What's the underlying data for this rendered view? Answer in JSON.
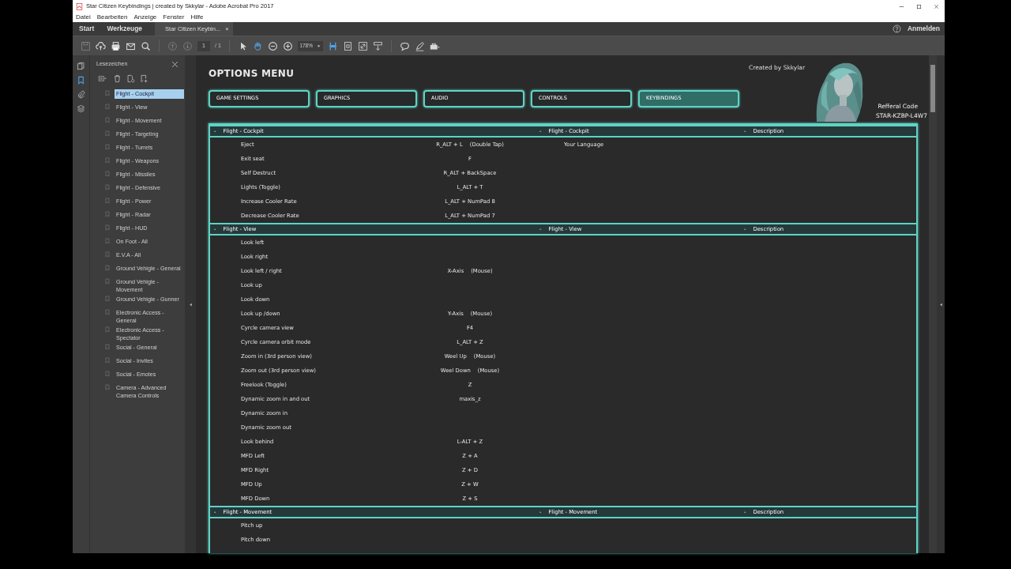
{
  "window": {
    "title": "Star Citizen Keybindings | created by Skkylar - Adobe Acrobat Pro 2017"
  },
  "menu": [
    "Datei",
    "Bearbeiten",
    "Anzeige",
    "Fenster",
    "Hilfe"
  ],
  "tabs": [
    {
      "label": "Start",
      "kind": "nav"
    },
    {
      "label": "Werkzeuge",
      "kind": "nav"
    },
    {
      "label": "Star Citizen Keybin...",
      "kind": "document",
      "close": "×"
    }
  ],
  "account": {
    "label": "Anmelden"
  },
  "toolbar": {
    "groups": [
      [
        {
          "kind": "save",
          "disabled": true,
          "active": false
        },
        {
          "kind": "upload",
          "disabled": false,
          "active": false
        },
        {
          "kind": "print",
          "disabled": false,
          "active": false
        },
        {
          "kind": "mail",
          "disabled": false,
          "active": false
        },
        {
          "kind": "search",
          "disabled": false,
          "active": false
        }
      ],
      [
        {
          "kind": "prev",
          "disabled": true,
          "active": false
        },
        {
          "kind": "next",
          "disabled": true,
          "active": false
        }
      ],
      [
        {
          "kind": "pointer",
          "disabled": false,
          "active": false
        },
        {
          "kind": "hand",
          "disabled": false,
          "active": true
        },
        {
          "kind": "zoomout",
          "disabled": false,
          "active": false
        },
        {
          "kind": "zoomin",
          "disabled": false,
          "active": false
        }
      ],
      [
        {
          "kind": "fitwidth",
          "disabled": false,
          "active": true
        },
        {
          "kind": "fitpage",
          "disabled": false,
          "active": false
        },
        {
          "kind": "fullscreen",
          "disabled": false,
          "active": false
        },
        {
          "kind": "scroll",
          "disabled": false,
          "active": false
        }
      ],
      [
        {
          "kind": "comment",
          "disabled": false,
          "active": false
        },
        {
          "kind": "pen",
          "disabled": false,
          "active": false
        },
        {
          "kind": "toolbox",
          "disabled": false,
          "active": false
        }
      ]
    ],
    "page": "1",
    "page_total": "/ 1",
    "zoom": "178%"
  },
  "side_icons": [
    {
      "kind": "pages",
      "selected": false
    },
    {
      "kind": "bookmarks",
      "selected": true
    },
    {
      "kind": "attachments",
      "selected": false
    },
    {
      "kind": "layers",
      "selected": false
    }
  ],
  "bookmarks": {
    "title": "Lesezeichen",
    "items": [
      {
        "label": "Flight - Cockpit",
        "selected": true
      },
      {
        "label": "Flight - View",
        "selected": false
      },
      {
        "label": "Flight - Movement",
        "selected": false
      },
      {
        "label": "Flight - Targeting",
        "selected": false
      },
      {
        "label": "Flight - Turrets",
        "selected": false
      },
      {
        "label": "Flight - Weapons",
        "selected": false
      },
      {
        "label": "Flight - Missiles",
        "selected": false
      },
      {
        "label": "Flight - Defensive",
        "selected": false
      },
      {
        "label": "Flight - Power",
        "selected": false
      },
      {
        "label": "Flight - Radar",
        "selected": false
      },
      {
        "label": "Flight - HUD",
        "selected": false
      },
      {
        "label": "On Foot - All",
        "selected": false
      },
      {
        "label": "E.V.A - All",
        "selected": false
      },
      {
        "label": "Ground Vehigle - General",
        "selected": false
      },
      {
        "label": "Ground Vehigle - Movement",
        "selected": false
      },
      {
        "label": "Ground Vehigle - Gunner",
        "selected": false
      },
      {
        "label": "Electronic Access - General",
        "selected": false
      },
      {
        "label": "Electronic Access - Spectator",
        "selected": false
      },
      {
        "label": "Social - General",
        "selected": false
      },
      {
        "label": "Social - Invites",
        "selected": false
      },
      {
        "label": "Social - Emotes",
        "selected": false
      },
      {
        "label": "Camera - Advanced Camera Controls",
        "selected": false
      }
    ]
  },
  "document": {
    "title": "OPTIONS MENU",
    "credit": "Created by Skkylar",
    "referral_label": "Refferal Code",
    "referral_code": "STAR-KZBP-L4W7",
    "menu_buttons": [
      {
        "label": "GAME SETTINGS",
        "selected": false
      },
      {
        "label": "GRAPHICS",
        "selected": false
      },
      {
        "label": "AUDIO",
        "selected": false
      },
      {
        "label": "CONTROLS",
        "selected": false
      },
      {
        "label": "KEYBINDINGS",
        "selected": true
      }
    ],
    "sections": [
      {
        "headers": [
          {
            "marker": "-",
            "text": "Flight - Cockpit"
          },
          {
            "marker": "-",
            "text": "Flight - Cockpit"
          },
          {
            "marker": "-",
            "text": "Description"
          }
        ],
        "rows": [
          {
            "action": "Eject",
            "key": "R_ALT + L",
            "key_note": "(Double Tap)",
            "language": "Your Language"
          },
          {
            "action": "Exit seat",
            "key": "F"
          },
          {
            "action": "Self Destruct",
            "key": "R_ALT + BackSpace"
          },
          {
            "action": "Lights (Toggle)",
            "key": "L_ALT + T"
          },
          {
            "action": "Increase Cooler Rate",
            "key": "L_ALT + NumPad 8"
          },
          {
            "action": "Decrease Cooler Rate",
            "key": "L_ALT + NumPad 7"
          }
        ]
      },
      {
        "headers": [
          {
            "marker": "-",
            "text": "Flight - View"
          },
          {
            "marker": "-",
            "text": "Flight - View"
          },
          {
            "marker": "-",
            "text": "Description"
          }
        ],
        "rows": [
          {
            "action": "Look left"
          },
          {
            "action": "Look right"
          },
          {
            "action": "Look left / right",
            "key": "X-Axis",
            "key_note": "(Mouse)"
          },
          {
            "action": "Look up"
          },
          {
            "action": "Look down"
          },
          {
            "action": "Look up /down",
            "key": "Y-Axis",
            "key_note": "(Mouse)"
          },
          {
            "action": "Cyrcle camera view",
            "key": "F4"
          },
          {
            "action": "Cyrcle camera orbit mode",
            "key": "L_ALT + Z"
          },
          {
            "action": "Zoom in (3rd person view)",
            "key": "Weel Up",
            "key_note": "(Mouse)"
          },
          {
            "action": "Zoom out (3rd person view)",
            "key": "Weel Down",
            "key_note": "(Mouse)"
          },
          {
            "action": "Freelook (Toggle)",
            "key": "Z"
          },
          {
            "action": "Dynamic zoom in and out",
            "key": "maxis_z"
          },
          {
            "action": "Dynamic zoom in"
          },
          {
            "action": "Dynamic zoom out"
          },
          {
            "action": "Look behind",
            "key": "L-ALT + Z"
          },
          {
            "action": "MFD Left",
            "key": "Z + A"
          },
          {
            "action": "MFD Right",
            "key": "Z + D"
          },
          {
            "action": "MFD Up",
            "key": "Z + W"
          },
          {
            "action": "MFD Down",
            "key": "Z + S"
          }
        ]
      },
      {
        "headers": [
          {
            "marker": "-",
            "text": "Flight - Movement"
          },
          {
            "marker": "-",
            "text": "Flight - Movement"
          },
          {
            "marker": "-",
            "text": "Description"
          }
        ],
        "rows": [
          {
            "action": "Pitch up"
          },
          {
            "action": "Pitch down"
          }
        ]
      }
    ]
  }
}
